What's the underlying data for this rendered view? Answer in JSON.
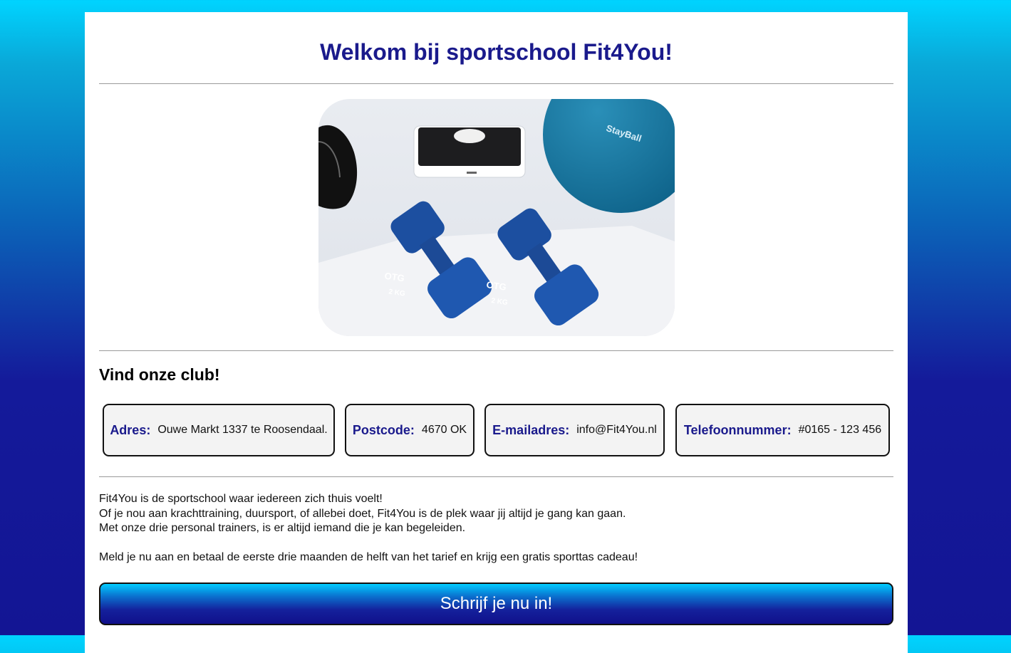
{
  "header": {
    "title": "Welkom bij sportschool Fit4You!"
  },
  "hero_image": {
    "icon": "dumbbells-photo",
    "ball_text": "StayBall",
    "dumbbell_brand": "OTG",
    "dumbbell_weight": "2 KG"
  },
  "club": {
    "heading": "Vind onze club!",
    "items": [
      {
        "label": "Adres:",
        "value": "Ouwe Markt 1337 te Roosendaal."
      },
      {
        "label": "Postcode:",
        "value": "4670 OK"
      },
      {
        "label": "E-mailadres:",
        "value": "info@Fit4You.nl"
      },
      {
        "label": "Telefoonnummer:",
        "value": "#0165 - 123 456"
      }
    ]
  },
  "intro": {
    "lines": [
      "Fit4You is de sportschool waar iedereen zich thuis voelt!",
      "Of je nou aan krachttraining, duursport, of allebei doet, Fit4You is de plek waar jij altijd je gang kan gaan.",
      "Met onze drie personal trainers, is er altijd iemand die je kan begeleiden."
    ],
    "promo": "Meld je nu aan en betaal de eerste drie maanden de helft van het tarief en krijg een gratis sporttas cadeau!"
  },
  "cta": {
    "label": "Schrijf je nu in!"
  },
  "colors": {
    "heading": "#1a1a8c",
    "background_top": "#00d4ff",
    "background_bottom": "#131594"
  }
}
